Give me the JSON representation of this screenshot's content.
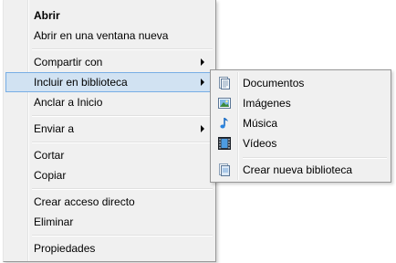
{
  "context_menu": {
    "items": [
      {
        "label": "Abrir"
      },
      {
        "label": "Abrir en una ventana nueva"
      },
      {
        "label": "Compartir con"
      },
      {
        "label": "Incluir en biblioteca"
      },
      {
        "label": "Anclar a Inicio"
      },
      {
        "label": "Enviar a"
      },
      {
        "label": "Cortar"
      },
      {
        "label": "Copiar"
      },
      {
        "label": "Crear acceso directo"
      },
      {
        "label": "Eliminar"
      },
      {
        "label": "Propiedades"
      }
    ]
  },
  "submenu": {
    "items": [
      {
        "label": "Documentos",
        "icon": "documents-library-icon"
      },
      {
        "label": "Imágenes",
        "icon": "pictures-library-icon"
      },
      {
        "label": "Música",
        "icon": "music-library-icon"
      },
      {
        "label": "Vídeos",
        "icon": "videos-library-icon"
      },
      {
        "label": "Crear nueva biblioteca",
        "icon": "new-library-icon"
      }
    ]
  },
  "colors": {
    "highlight_bg": "#d1e2f2",
    "highlight_border": "#78aee5",
    "menu_bg": "#f0f0f0"
  }
}
